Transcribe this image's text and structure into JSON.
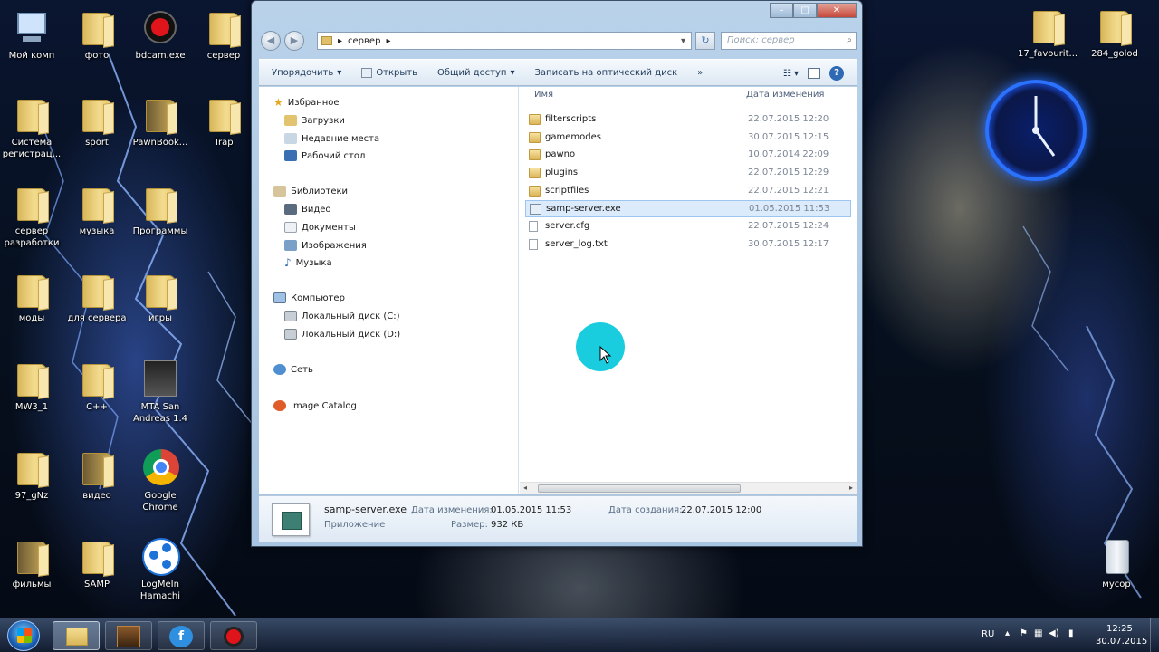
{
  "desktop": {
    "icons": [
      {
        "label": "Мой комп"
      },
      {
        "label": "фото"
      },
      {
        "label": "bdcam.exe"
      },
      {
        "label": "сервер"
      },
      {
        "label": "Система регистрац..."
      },
      {
        "label": "sport"
      },
      {
        "label": "PawnBook..."
      },
      {
        "label": "Trap"
      },
      {
        "label": "сервер разработки"
      },
      {
        "label": "музыка"
      },
      {
        "label": "Программы"
      },
      {
        "label": "моды"
      },
      {
        "label": "для сервера"
      },
      {
        "label": "игры"
      },
      {
        "label": "MW3_1"
      },
      {
        "label": "C++"
      },
      {
        "label": "MTA San Andreas 1.4"
      },
      {
        "label": "97_gNz"
      },
      {
        "label": "видео"
      },
      {
        "label": "Google Chrome"
      },
      {
        "label": "фильмы"
      },
      {
        "label": "SAMP"
      },
      {
        "label": "LogMeIn Hamachi"
      },
      {
        "label": "17_favourit..."
      },
      {
        "label": "284_golod"
      },
      {
        "label": "мусор"
      }
    ]
  },
  "explorer": {
    "address": {
      "breadcrumb": "сервер",
      "search_placeholder": "Поиск: сервер"
    },
    "caption": {
      "minimize": "–",
      "maximize": "□",
      "close": "✕"
    },
    "toolbar": {
      "organize": "Упорядочить",
      "open": "Открыть",
      "share": "Общий доступ",
      "burn": "Записать на оптический диск",
      "more": "»"
    },
    "nav": {
      "favorites": "Избранное",
      "downloads": "Загрузки",
      "recent": "Недавние места",
      "desktop": "Рабочий стол",
      "libraries": "Библиотеки",
      "video": "Видео",
      "documents": "Документы",
      "images": "Изображения",
      "music": "Музыка",
      "computer": "Компьютер",
      "disk_c": "Локальный диск (C:)",
      "disk_d": "Локальный диск (D:)",
      "network": "Сеть",
      "image_catalog": "Image Catalog"
    },
    "columns": {
      "name": "Имя",
      "date": "Дата изменения"
    },
    "files": [
      {
        "name": "filterscripts",
        "date": "22.07.2015 12:20",
        "kind": "folder"
      },
      {
        "name": "gamemodes",
        "date": "30.07.2015 12:15",
        "kind": "folder"
      },
      {
        "name": "pawno",
        "date": "10.07.2014 22:09",
        "kind": "folder"
      },
      {
        "name": "plugins",
        "date": "22.07.2015 12:29",
        "kind": "folder"
      },
      {
        "name": "scriptfiles",
        "date": "22.07.2015 12:21",
        "kind": "folder"
      },
      {
        "name": "samp-server.exe",
        "date": "01.05.2015 11:53",
        "kind": "exe"
      },
      {
        "name": "server.cfg",
        "date": "22.07.2015 12:24",
        "kind": "file"
      },
      {
        "name": "server_log.txt",
        "date": "30.07.2015 12:17",
        "kind": "file"
      }
    ],
    "details": {
      "name": "samp-server.exe",
      "type": "Приложение",
      "modified_label": "Дата изменения:",
      "modified_value": "01.05.2015 11:53",
      "size_label": "Размер:",
      "size_value": "932 КБ",
      "created_label": "Дата создания:",
      "created_value": "22.07.2015 12:00"
    }
  },
  "taskbar": {
    "lang": "RU",
    "time": "12:25",
    "date": "30.07.2015"
  },
  "colors": {
    "selection": "#dcebfc",
    "cursor_highlight": "#00c8dc",
    "window_frame": "#b9d2ea"
  }
}
